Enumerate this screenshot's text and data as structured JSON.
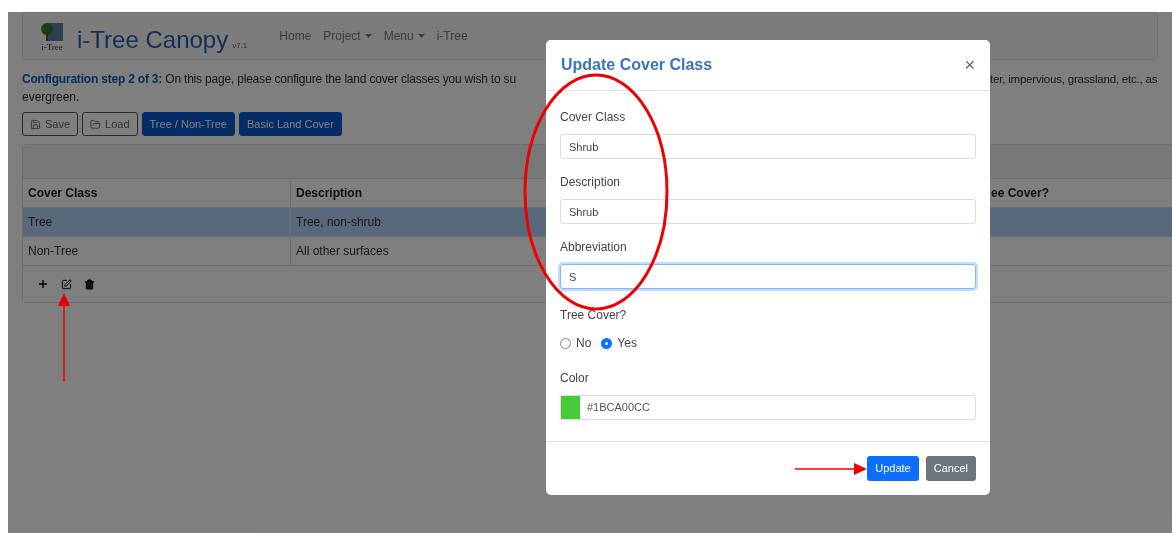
{
  "header": {
    "logo_caption": "i-Tree",
    "title": "i-Tree Canopy",
    "version": "v7.1",
    "nav": [
      {
        "label": "Home",
        "dropdown": false
      },
      {
        "label": "Project",
        "dropdown": true
      },
      {
        "label": "Menu",
        "dropdown": true
      },
      {
        "label": "i-Tree",
        "dropdown": false
      }
    ]
  },
  "intro": {
    "left": "**Configuration step 2 of 3:** On this page, please configure the land cover classes you wish to su",
    "right": "ter, impervious, grassland, etc., as",
    "line2": "evergreen."
  },
  "toolbar": [
    {
      "label": "Save",
      "kind": "outline"
    },
    {
      "label": "Load",
      "kind": "outline"
    },
    {
      "label": "Tree / Non-Tree",
      "kind": "primary"
    },
    {
      "label": "Basic Land Cover",
      "kind": "primary"
    }
  ],
  "table": {
    "columns": [
      "Cover Class",
      "Description",
      "ee Cover?"
    ],
    "rows": [
      {
        "cells": [
          "Tree",
          "Tree, non-shrub"
        ],
        "selected": true
      },
      {
        "cells": [
          "Non-Tree",
          "All other surfaces"
        ],
        "selected": false
      }
    ]
  },
  "modal": {
    "title": "Update Cover Class",
    "close": "×",
    "fields": [
      {
        "label": "Cover Class",
        "value": "Shrub",
        "focused": false
      },
      {
        "label": "Description",
        "value": "Shrub",
        "focused": false
      },
      {
        "label": "Abbreviation",
        "value": "S",
        "focused": true
      }
    ],
    "tree_cover": {
      "label": "Tree Cover?",
      "options": [
        {
          "label": "No",
          "selected": false
        },
        {
          "label": "Yes",
          "selected": true
        }
      ]
    },
    "color": {
      "label": "Color",
      "value": "#1BCA00CC",
      "color": "#46cc3a"
    },
    "buttons": [
      {
        "label": "Update",
        "kind": "primary"
      },
      {
        "label": "Cancel",
        "kind": "secondary"
      }
    ]
  }
}
